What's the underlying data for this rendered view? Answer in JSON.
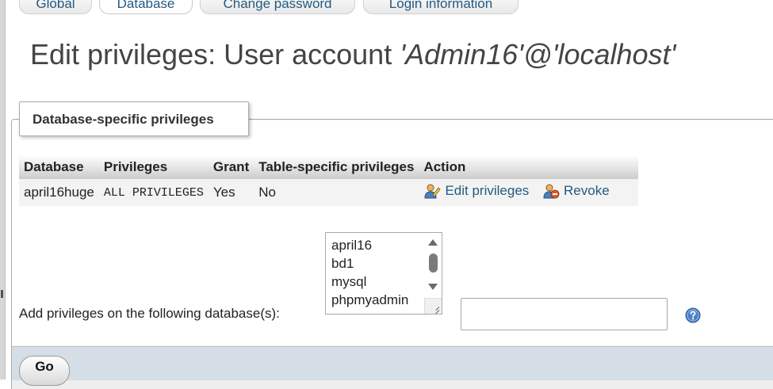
{
  "tabs": [
    {
      "label": "Global",
      "active": false
    },
    {
      "label": "Database",
      "active": true
    },
    {
      "label": "Change password",
      "active": false
    },
    {
      "label": "Login information",
      "active": false
    }
  ],
  "title": {
    "prefix": "Edit privileges: User account ",
    "account": "'Admin16'@'localhost'"
  },
  "section": {
    "legend": "Database-specific privileges"
  },
  "table": {
    "headers": {
      "database": "Database",
      "privileges": "Privileges",
      "grant": "Grant",
      "table_privileges": "Table-specific privileges",
      "action": "Action"
    },
    "rows": [
      {
        "database": "april16huge",
        "privileges": "ALL PRIVILEGES",
        "grant": "Yes",
        "table_privileges": "No",
        "edit_label": "Edit privileges",
        "revoke_label": "Revoke"
      }
    ]
  },
  "add_privileges": {
    "label": "Add privileges on the following database(s):",
    "options": [
      "april16",
      "bd1",
      "mysql",
      "phpmyadmin"
    ],
    "input_value": ""
  },
  "footer": {
    "go_label": "Go"
  },
  "icons": {
    "edit": "edit-privileges-icon",
    "revoke": "revoke-icon",
    "help": "help-icon"
  },
  "colors": {
    "link": "#235a81",
    "footer": "#d5dde6",
    "help": "#4a7fc1"
  }
}
